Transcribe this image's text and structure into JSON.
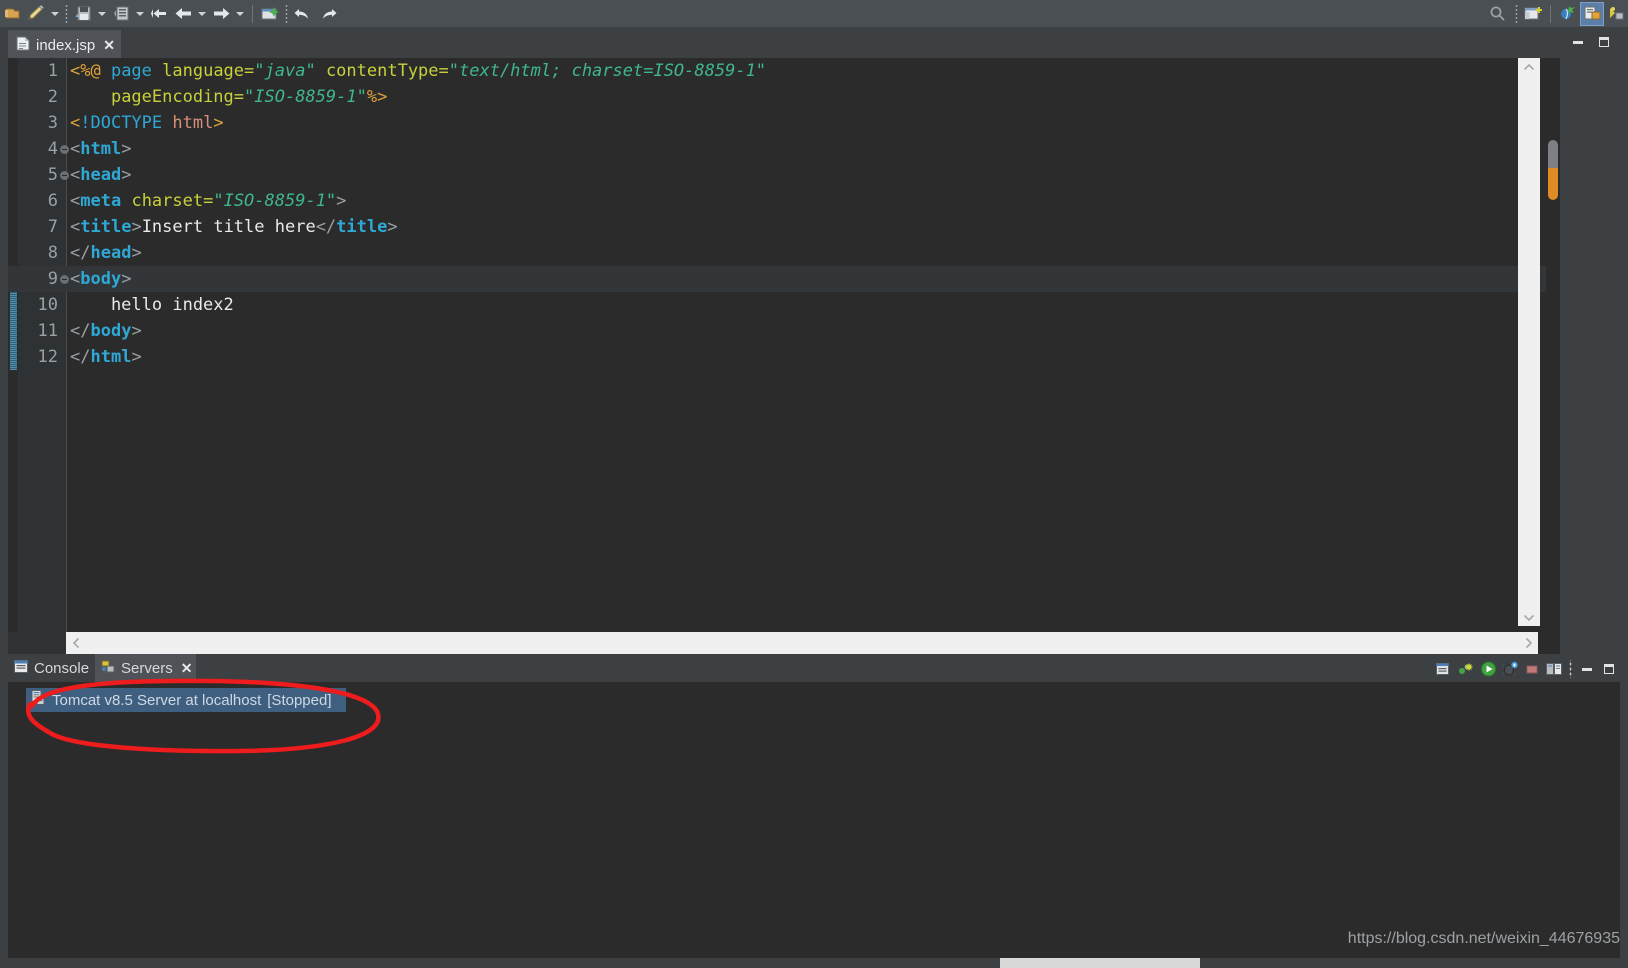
{
  "toolbar": {
    "items": [
      {
        "name": "new-wizard-icon",
        "glyph": "▤"
      },
      {
        "name": "quick-access-pencil-icon",
        "glyph": "✎"
      },
      {
        "name": "new-dropdown-arrow",
        "glyph": "▾"
      },
      {
        "name": "save-icon",
        "glyph": "⤓"
      },
      {
        "name": "save-dropdown-arrow",
        "glyph": "▾"
      },
      {
        "name": "publish-icon",
        "glyph": "⤒"
      },
      {
        "name": "publish-dropdown-arrow",
        "glyph": "▾"
      },
      {
        "name": "back-history-icon",
        "glyph": "⇦"
      },
      {
        "name": "back-icon",
        "glyph": "←"
      },
      {
        "name": "back-dropdown-arrow",
        "glyph": "▾"
      },
      {
        "name": "forward-icon",
        "glyph": "→"
      },
      {
        "name": "forward-dropdown-arrow",
        "glyph": "▾"
      },
      {
        "name": "run-as-icon",
        "glyph": "▶"
      },
      {
        "name": "undo-icon",
        "glyph": "↩"
      },
      {
        "name": "redo-icon",
        "glyph": "↪"
      }
    ],
    "search_icon": "search-icon",
    "perspective_icons": [
      "new-perspective-icon",
      "java-ee-perspective-icon",
      "java-perspective-icon",
      "web-perspective-icon"
    ]
  },
  "editor": {
    "tab": {
      "label": "index.jsp",
      "icon": "jsp-file-icon",
      "close": "✕"
    },
    "window_buttons": {
      "minimize": "minimize-icon",
      "maximize": "maximize-icon"
    },
    "scroll": {
      "up_arrow": "⌃",
      "down_arrow": "⌄",
      "left_arrow": "‹",
      "right_arrow": "›"
    },
    "marker_colors": {
      "gray": "#7c8084",
      "orange": "#e08a26",
      "change_bar": "#4d8fb0"
    },
    "current_line": 9,
    "folding_lines": [
      4,
      5,
      9
    ],
    "lines": [
      {
        "n": 1,
        "tokens": [
          {
            "c": "t-dir",
            "t": "<%@ "
          },
          {
            "c": "t-key",
            "t": "page "
          },
          {
            "c": "t-attr",
            "t": "language="
          },
          {
            "c": "t-val",
            "t": "\"java\""
          },
          {
            "c": "t-plain",
            "t": " "
          },
          {
            "c": "t-attr",
            "t": "contentType="
          },
          {
            "c": "t-val",
            "t": "\"text/html; charset=ISO-8859-1\""
          }
        ]
      },
      {
        "n": 2,
        "tokens": [
          {
            "c": "t-plain",
            "t": "    "
          },
          {
            "c": "t-attr",
            "t": "pageEncoding="
          },
          {
            "c": "t-val",
            "t": "\"ISO-8859-1\""
          },
          {
            "c": "t-dir",
            "t": "%>"
          }
        ]
      },
      {
        "n": 3,
        "tokens": [
          {
            "c": "t-dir",
            "t": "<"
          },
          {
            "c": "t-key",
            "t": "!DOCTYPE "
          },
          {
            "c": "t-doc",
            "t": "html"
          },
          {
            "c": "t-dir",
            "t": ">"
          }
        ]
      },
      {
        "n": 4,
        "tokens": [
          {
            "c": "t-brk",
            "t": "<"
          },
          {
            "c": "t-tag",
            "t": "html"
          },
          {
            "c": "t-brk",
            "t": ">"
          }
        ]
      },
      {
        "n": 5,
        "tokens": [
          {
            "c": "t-brk",
            "t": "<"
          },
          {
            "c": "t-tag",
            "t": "head"
          },
          {
            "c": "t-brk",
            "t": ">"
          }
        ]
      },
      {
        "n": 6,
        "tokens": [
          {
            "c": "t-brk",
            "t": "<"
          },
          {
            "c": "t-tag",
            "t": "meta"
          },
          {
            "c": "t-plain",
            "t": " "
          },
          {
            "c": "t-attr",
            "t": "charset="
          },
          {
            "c": "t-val",
            "t": "\"ISO-8859-1\""
          },
          {
            "c": "t-brk",
            "t": ">"
          }
        ]
      },
      {
        "n": 7,
        "tokens": [
          {
            "c": "t-brk",
            "t": "<"
          },
          {
            "c": "t-tag",
            "t": "title"
          },
          {
            "c": "t-brk",
            "t": ">"
          },
          {
            "c": "t-txt",
            "t": "Insert title here"
          },
          {
            "c": "t-brk",
            "t": "</"
          },
          {
            "c": "t-tag",
            "t": "title"
          },
          {
            "c": "t-brk",
            "t": ">"
          }
        ]
      },
      {
        "n": 8,
        "tokens": [
          {
            "c": "t-brk",
            "t": "</"
          },
          {
            "c": "t-tag",
            "t": "head"
          },
          {
            "c": "t-brk",
            "t": ">"
          }
        ]
      },
      {
        "n": 9,
        "tokens": [
          {
            "c": "t-brk",
            "t": "<"
          },
          {
            "c": "t-tag",
            "t": "body"
          },
          {
            "c": "t-brk",
            "t": ">"
          }
        ]
      },
      {
        "n": 10,
        "tokens": [
          {
            "c": "t-txt",
            "t": "    hello index2"
          }
        ]
      },
      {
        "n": 11,
        "tokens": [
          {
            "c": "t-brk",
            "t": "</"
          },
          {
            "c": "t-tag",
            "t": "body"
          },
          {
            "c": "t-brk",
            "t": ">"
          }
        ]
      },
      {
        "n": 12,
        "tokens": [
          {
            "c": "t-brk",
            "t": "</"
          },
          {
            "c": "t-tag",
            "t": "html"
          },
          {
            "c": "t-brk",
            "t": ">"
          }
        ]
      }
    ]
  },
  "panel": {
    "tabs": [
      {
        "label": "Console",
        "icon": "console-icon",
        "active": false,
        "closable": false
      },
      {
        "label": "Servers",
        "icon": "servers-icon",
        "active": true,
        "closable": true
      }
    ],
    "close_glyph": "✕",
    "toolbar_icons": [
      "open-console-icon",
      "new-console-view-icon",
      "start-server-icon",
      "debug-server-icon",
      "terminate-icon",
      "display-selected-console-icon",
      "view-menu-icon",
      "minimize-icon",
      "maximize-icon"
    ],
    "server": {
      "icon": "server-icon",
      "name": "Tomcat v8.5 Server at localhost",
      "state": "[Stopped]",
      "selected_bg": "#3f5f80"
    }
  },
  "annotation": {
    "shape": "hand-drawn-red-ellipse",
    "color": "#ee1c1c"
  },
  "watermark": {
    "text": "https://blog.csdn.net/weixin_44676935"
  }
}
